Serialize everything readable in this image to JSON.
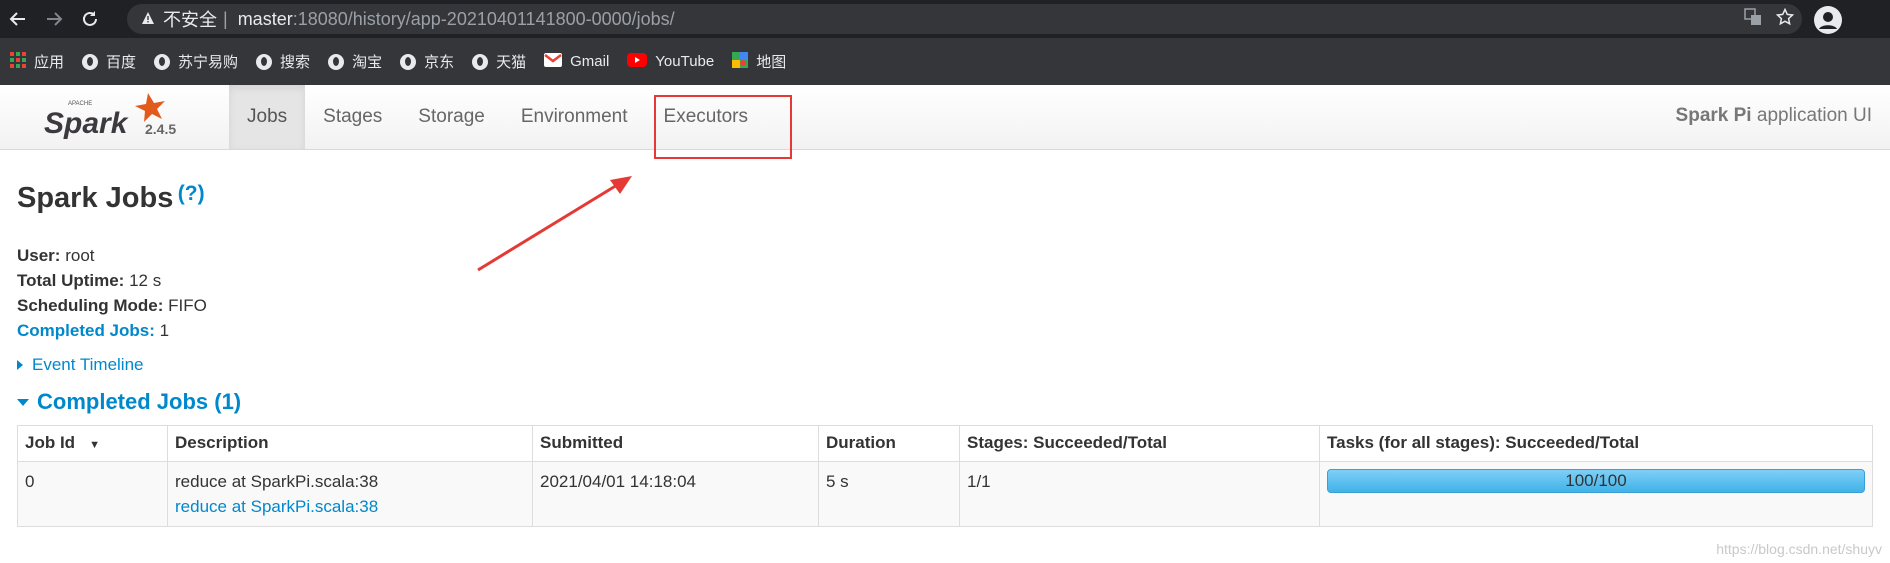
{
  "browser": {
    "address_insecure": "不安全",
    "address_separator": "|",
    "address_host": "master",
    "address_rest": ":18080/history/app-20210401141800-0000/jobs/",
    "bookmarks": [
      {
        "label": "应用",
        "icon": "apps-grid-icon"
      },
      {
        "label": "百度",
        "icon": "globe-icon"
      },
      {
        "label": "苏宁易购",
        "icon": "globe-icon"
      },
      {
        "label": "搜索",
        "icon": "globe-icon"
      },
      {
        "label": "淘宝",
        "icon": "globe-icon"
      },
      {
        "label": "京东",
        "icon": "globe-icon"
      },
      {
        "label": "天猫",
        "icon": "globe-icon"
      },
      {
        "label": "Gmail",
        "icon": "gmail-icon"
      },
      {
        "label": "YouTube",
        "icon": "youtube-icon"
      },
      {
        "label": "地图",
        "icon": "maps-icon"
      }
    ]
  },
  "spark": {
    "logo_top": "APACHE",
    "logo_word": "Spark",
    "version": "2.4.5",
    "tabs": [
      {
        "label": "Jobs",
        "active": true
      },
      {
        "label": "Stages",
        "active": false
      },
      {
        "label": "Storage",
        "active": false
      },
      {
        "label": "Environment",
        "active": false
      },
      {
        "label": "Executors",
        "active": false
      }
    ],
    "app_name": "Spark Pi",
    "app_suffix": "application UI"
  },
  "page": {
    "title": "Spark Jobs",
    "help": "(?)",
    "user_label": "User:",
    "user_value": "root",
    "uptime_label": "Total Uptime:",
    "uptime_value": "12 s",
    "mode_label": "Scheduling Mode:",
    "mode_value": "FIFO",
    "completed_label": "Completed Jobs:",
    "completed_value": "1",
    "event_timeline": "Event Timeline",
    "section_title": "Completed Jobs (1)"
  },
  "table": {
    "headers": [
      "Job Id",
      "Description",
      "Submitted",
      "Duration",
      "Stages: Succeeded/Total",
      "Tasks (for all stages): Succeeded/Total"
    ],
    "rows": [
      {
        "job_id": "0",
        "description": "reduce at SparkPi.scala:38",
        "description_link": "reduce at SparkPi.scala:38",
        "submitted": "2021/04/01 14:18:04",
        "duration": "5 s",
        "stages": "1/1",
        "tasks": "100/100",
        "tasks_fraction": 1.0
      }
    ]
  },
  "watermark": "https://blog.csdn.net/shuyv",
  "colors": {
    "link": "#0088cc",
    "highlight_box": "#e53935",
    "progress": "#41b2e8"
  }
}
